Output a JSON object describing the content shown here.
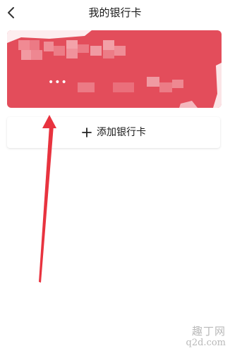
{
  "nav": {
    "title": "我的银行卡",
    "back_icon": "chevron-left-icon"
  },
  "card": {
    "masked_digits": "•••",
    "color": "#e34d5b",
    "state": "obscured"
  },
  "add_card": {
    "label": "添加银行卡",
    "icon": "plus-icon"
  },
  "annotation": {
    "arrow_color": "#e8333f"
  },
  "watermark": {
    "line1": "趣丁网",
    "line2": "q2d.com"
  }
}
